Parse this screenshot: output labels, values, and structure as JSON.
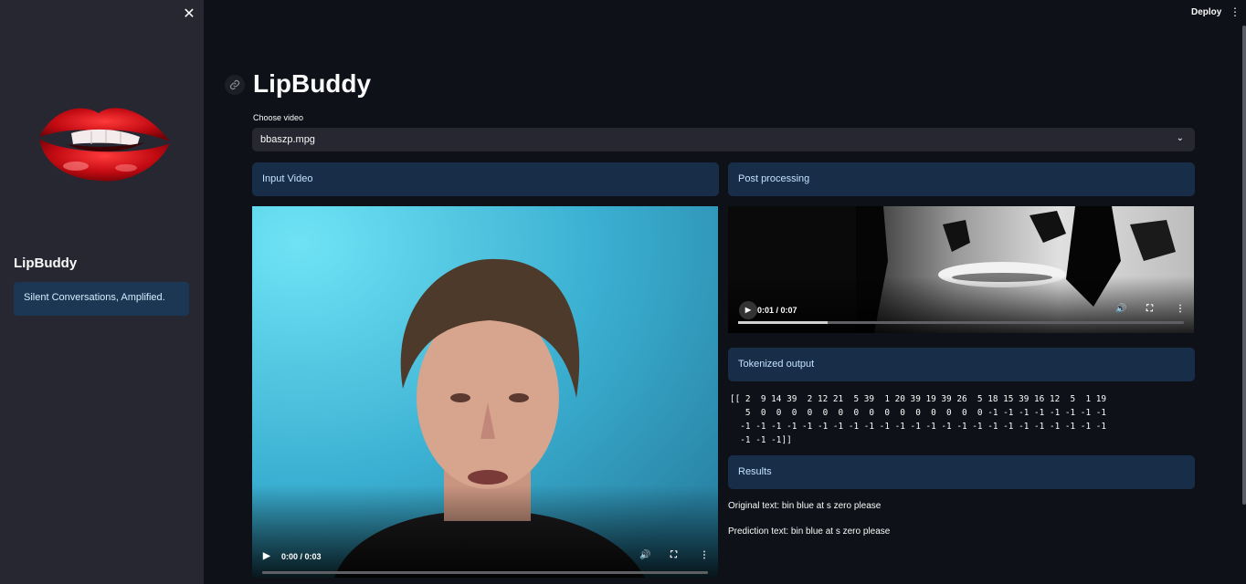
{
  "sidebar": {
    "title": "LipBuddy",
    "info": "Silent Conversations, Amplified."
  },
  "header": {
    "deploy_label": "Deploy",
    "title": "LipBuddy"
  },
  "video_select": {
    "label": "Choose video",
    "value": "bbaszp.mpg"
  },
  "left_column": {
    "heading": "Input Video",
    "player": {
      "time": "0:00 / 0:03",
      "progress": 0
    }
  },
  "right_column": {
    "processing_heading": "Post processing",
    "player": {
      "time": "0:01 / 0:07",
      "progress": 0.2
    },
    "tokens_heading": "Tokenized output",
    "tokens_text": "[[ 2  9 14 39  2 12 21  5 39  1 20 39 19 39 26  5 18 15 39 16 12  5  1 19\n   5  0  0  0  0  0  0  0  0  0  0  0  0  0  0  0 -1 -1 -1 -1 -1 -1 -1 -1\n  -1 -1 -1 -1 -1 -1 -1 -1 -1 -1 -1 -1 -1 -1 -1 -1 -1 -1 -1 -1 -1 -1 -1 -1\n  -1 -1 -1]]",
    "results_heading": "Results",
    "original_text": "Original text: bin blue at s zero please",
    "prediction_text": "Prediction text: bin blue at s zero please"
  },
  "colors": {
    "background": "#0e1117",
    "sidebar": "#262730",
    "info_box": "#172d48",
    "video_bg": "#38b2d6"
  }
}
